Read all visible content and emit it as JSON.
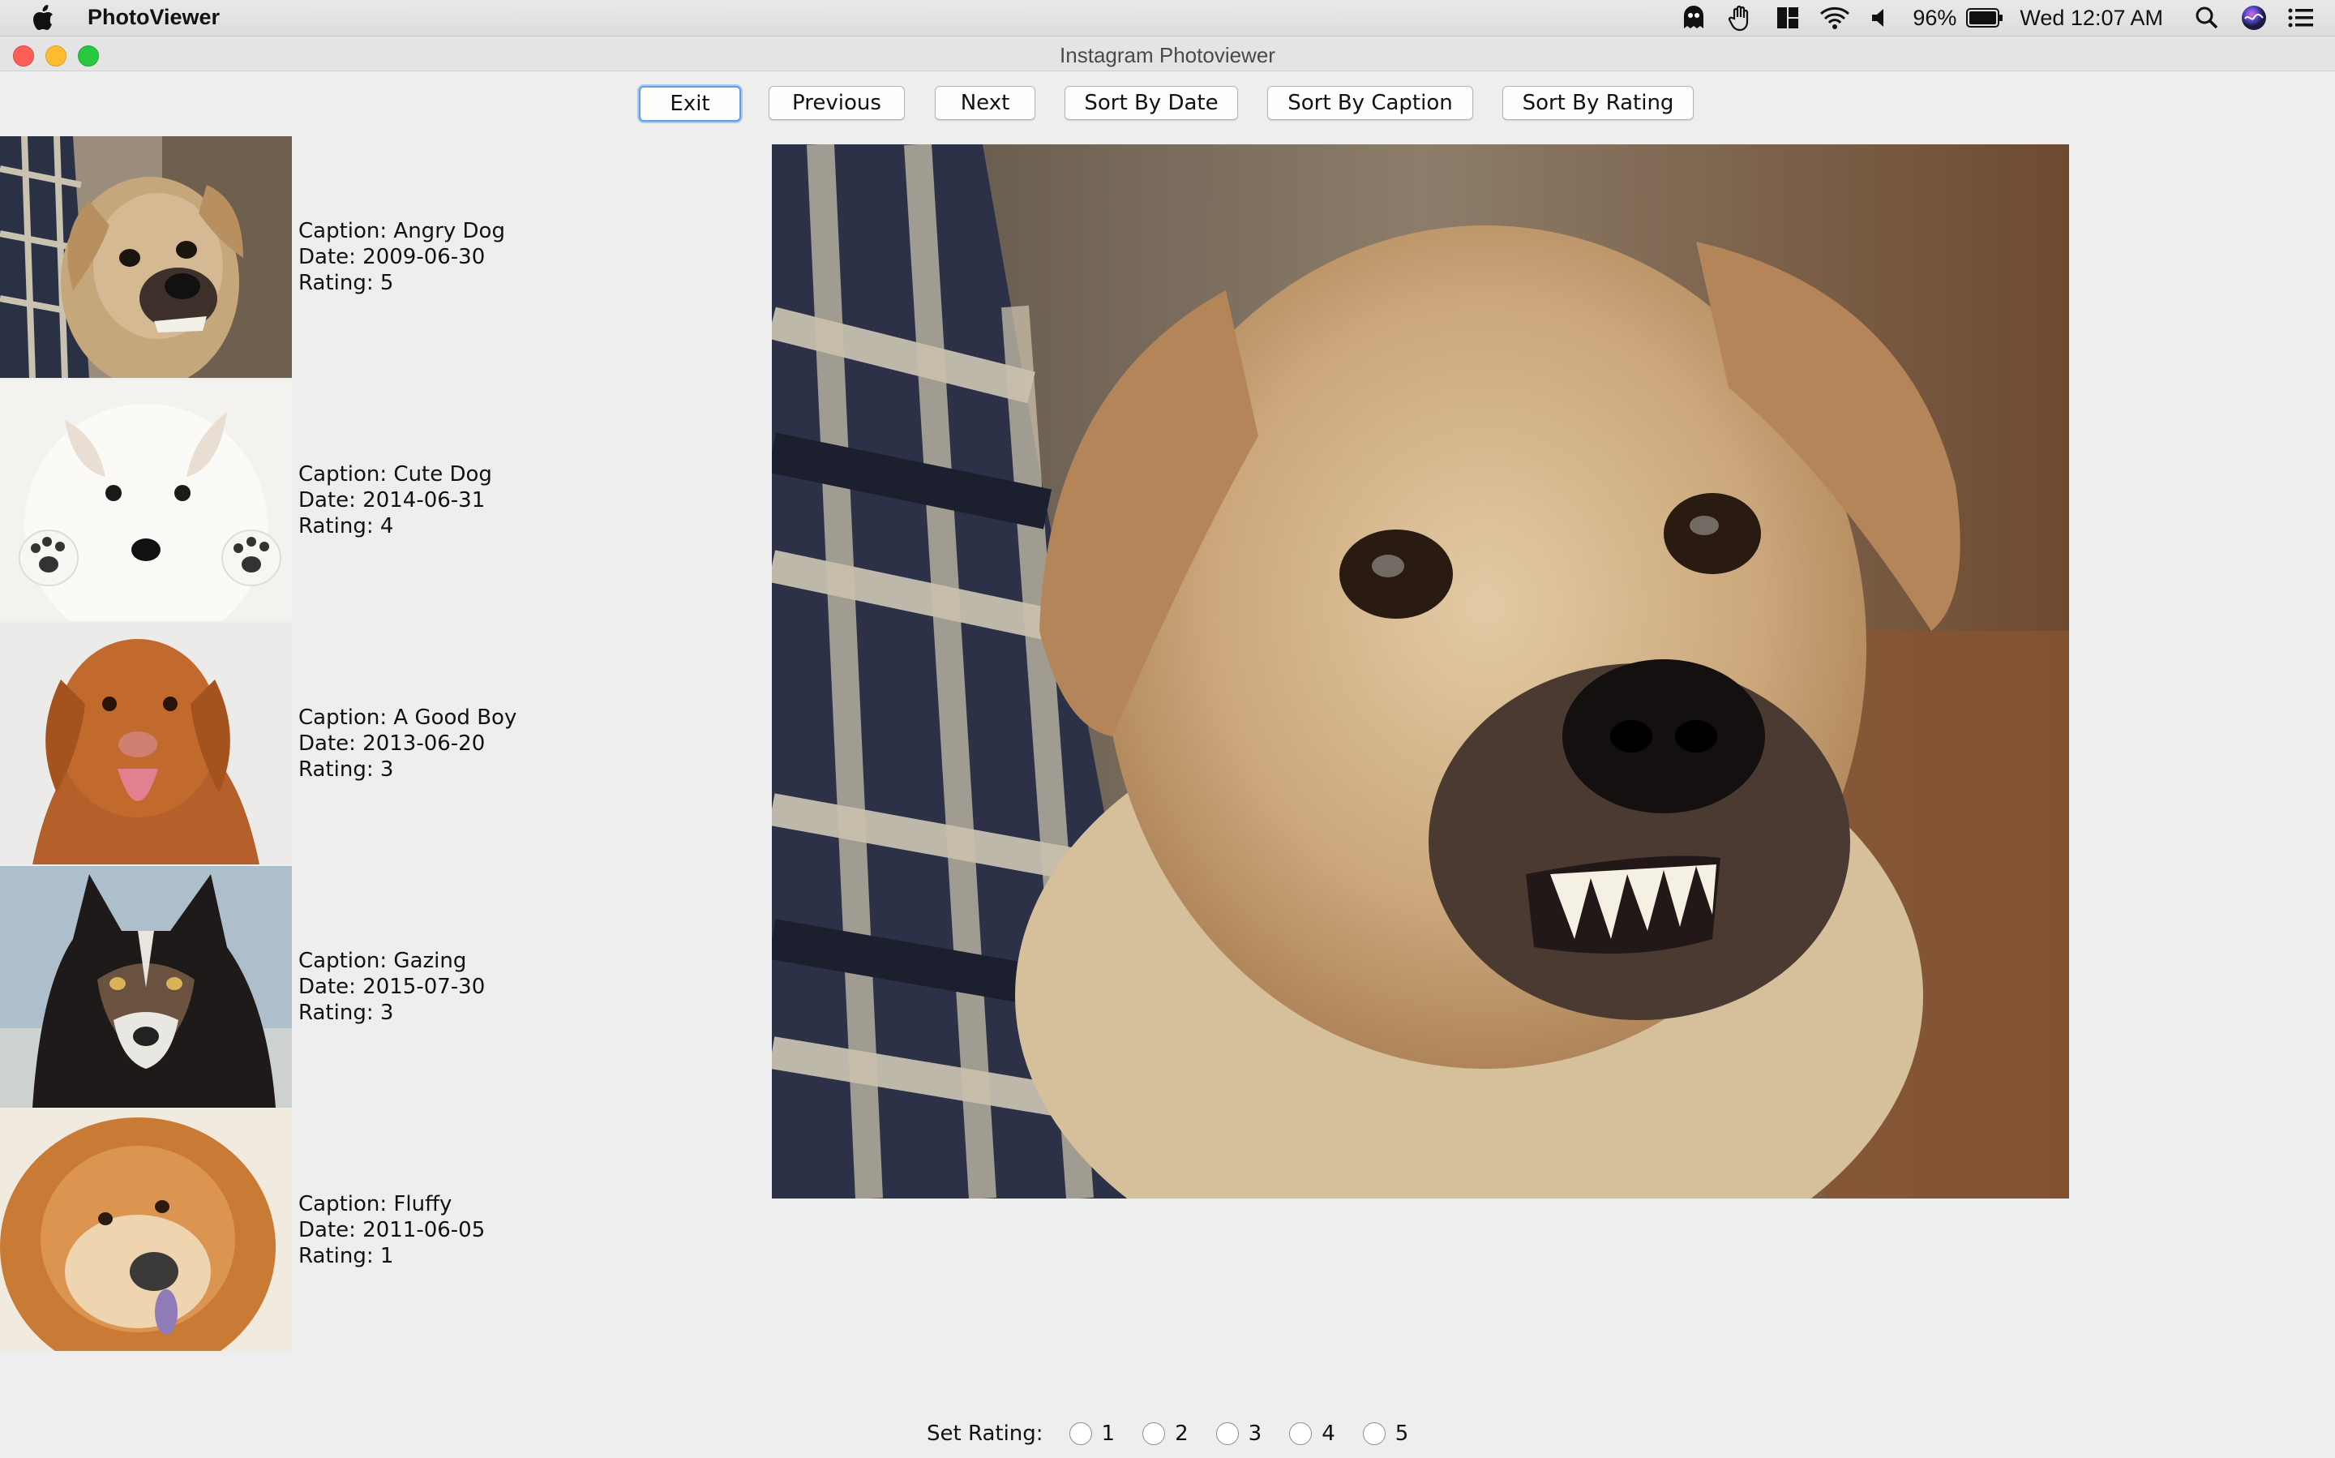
{
  "menubar": {
    "app_name": "PhotoViewer",
    "battery": "96%",
    "clock": "Wed 12:07 AM"
  },
  "window": {
    "title": "Instagram Photoviewer"
  },
  "toolbar": {
    "exit": "Exit",
    "previous": "Previous",
    "next": "Next",
    "sort_date": "Sort By Date",
    "sort_caption": "Sort By Caption",
    "sort_rating": "Sort By Rating"
  },
  "photos": [
    {
      "caption": "Caption: Angry Dog",
      "date": "Date: 2009-06-30",
      "rating": "Rating: 5"
    },
    {
      "caption": "Caption: Cute Dog",
      "date": "Date: 2014-06-31",
      "rating": "Rating: 4"
    },
    {
      "caption": "Caption: A Good Boy",
      "date": "Date: 2013-06-20",
      "rating": "Rating: 3"
    },
    {
      "caption": "Caption: Gazing",
      "date": "Date: 2015-07-30",
      "rating": "Rating: 3"
    },
    {
      "caption": "Caption: Fluffy",
      "date": "Date: 2011-06-05",
      "rating": "Rating: 1"
    }
  ],
  "set_rating": {
    "label": "Set Rating:",
    "options": [
      "1",
      "2",
      "3",
      "4",
      "5"
    ]
  }
}
